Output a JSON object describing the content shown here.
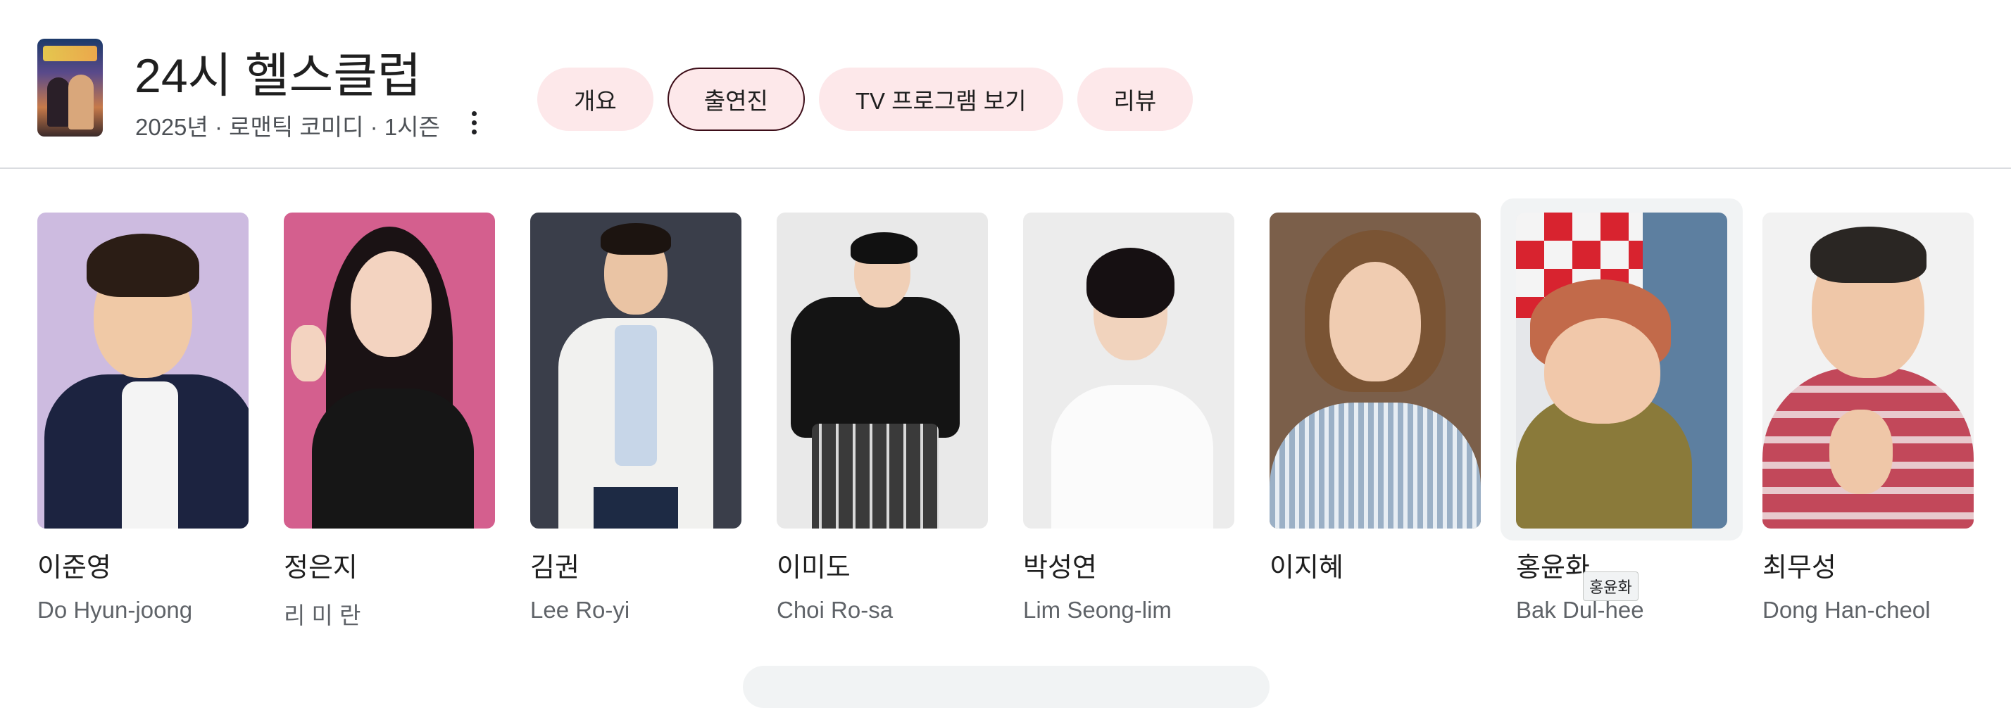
{
  "header": {
    "title": "24시 헬스클럽",
    "subtitle": "2025년 · 로맨틱 코미디 · 1시즌",
    "tabs": [
      {
        "label": "개요",
        "selected": false
      },
      {
        "label": "출연진",
        "selected": true
      },
      {
        "label": "TV 프로그램 보기",
        "selected": false
      },
      {
        "label": "리뷰",
        "selected": false
      }
    ]
  },
  "cast": [
    {
      "name": "이준영",
      "role": "Do Hyun-joong"
    },
    {
      "name": "정은지",
      "role": "리 미 란"
    },
    {
      "name": "김권",
      "role": "Lee Ro-yi"
    },
    {
      "name": "이미도",
      "role": "Choi Ro-sa"
    },
    {
      "name": "박성연",
      "role": "Lim Seong-lim"
    },
    {
      "name": "이지혜",
      "role": ""
    },
    {
      "name": "홍윤화",
      "role": "Bak Dul-hee"
    },
    {
      "name": "최무성",
      "role": "Dong Han-cheol"
    }
  ],
  "tooltip": "홍윤화",
  "colors": {
    "chip_bg": "#fde8ea",
    "chip_selected_border": "#3c0d18",
    "hover_bg": "#f1f3f4"
  }
}
